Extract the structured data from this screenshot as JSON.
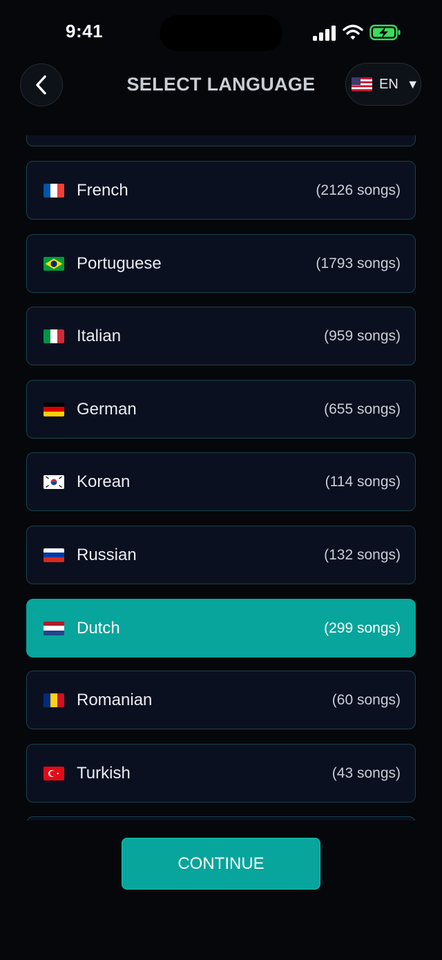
{
  "status_bar": {
    "time": "9:41",
    "signal_icon": "cellular-signal-icon",
    "wifi_icon": "wifi-icon",
    "battery_icon": "battery-charging-icon"
  },
  "header": {
    "title": "SELECT LANGUAGE",
    "back_icon": "chevron-left-icon",
    "language_code": "EN",
    "language_flag_icon": "us-flag-icon",
    "caret_icon": "caret-down-icon",
    "caret_glyph": "▼"
  },
  "languages": [
    {
      "name": "French",
      "count": "(2126 songs)",
      "flag_icon": "france-flag-icon",
      "selected": false
    },
    {
      "name": "Portuguese",
      "count": "(1793 songs)",
      "flag_icon": "brazil-flag-icon",
      "selected": false
    },
    {
      "name": "Italian",
      "count": "(959 songs)",
      "flag_icon": "italy-flag-icon",
      "selected": false
    },
    {
      "name": "German",
      "count": "(655 songs)",
      "flag_icon": "germany-flag-icon",
      "selected": false
    },
    {
      "name": "Korean",
      "count": "(114 songs)",
      "flag_icon": "south-korea-flag-icon",
      "selected": false
    },
    {
      "name": "Russian",
      "count": "(132 songs)",
      "flag_icon": "russia-flag-icon",
      "selected": false
    },
    {
      "name": "Dutch",
      "count": "(299 songs)",
      "flag_icon": "netherlands-flag-icon",
      "selected": true
    },
    {
      "name": "Romanian",
      "count": "(60 songs)",
      "flag_icon": "romania-flag-icon",
      "selected": false
    },
    {
      "name": "Turkish",
      "count": "(43 songs)",
      "flag_icon": "turkey-flag-icon",
      "selected": false
    }
  ],
  "continue_label": "CONTINUE",
  "colors": {
    "accent": "#07a59c",
    "background": "#05070b",
    "card": "#0b1020",
    "card_border": "#17434a",
    "battery": "#3ddc5a"
  }
}
